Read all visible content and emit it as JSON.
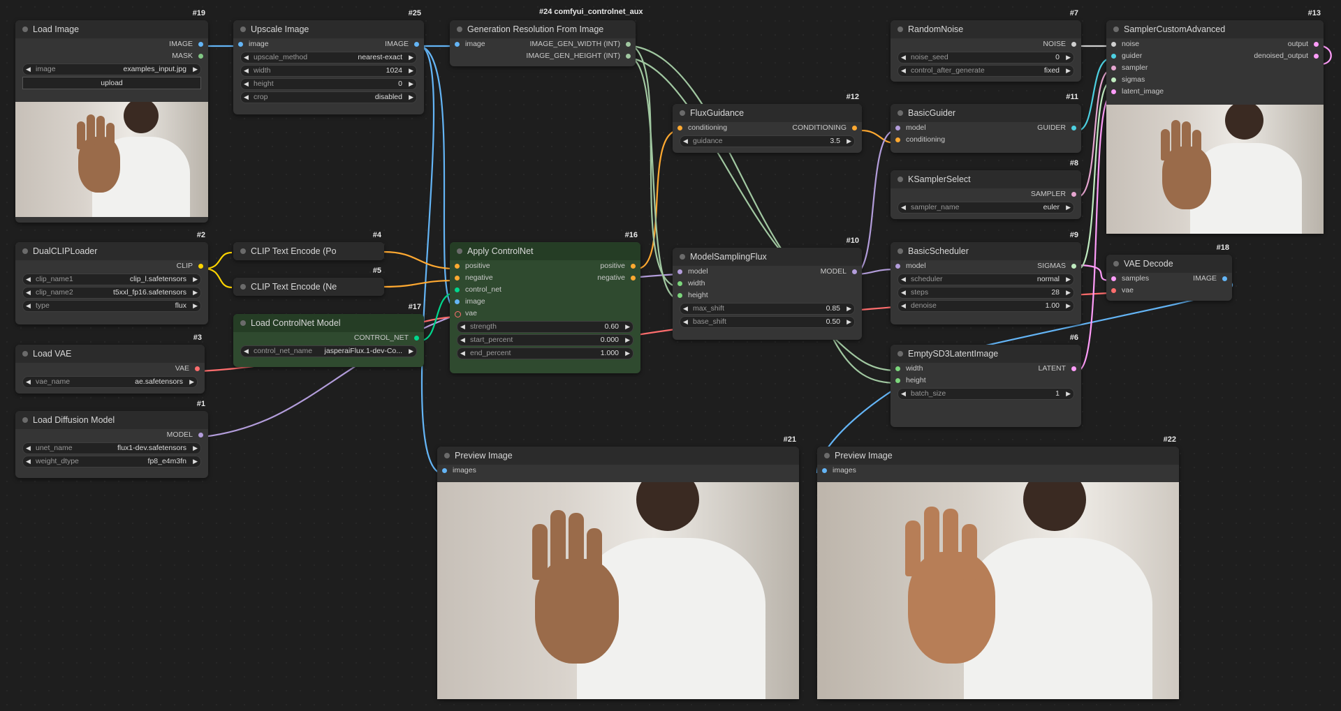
{
  "group_label": "#24 comfyui_controlnet_aux",
  "nodes": {
    "load_image": {
      "id": "#19",
      "title": "Load Image",
      "out1": "IMAGE",
      "out2": "MASK",
      "w_image_label": "image",
      "w_image_value": "examples_input.jpg",
      "upload": "upload"
    },
    "upscale": {
      "id": "#25",
      "title": "Upscale Image",
      "in1": "image",
      "out1": "IMAGE",
      "widgets": [
        {
          "label": "upscale_method",
          "value": "nearest-exact"
        },
        {
          "label": "width",
          "value": "1024"
        },
        {
          "label": "height",
          "value": "0"
        },
        {
          "label": "crop",
          "value": "disabled"
        }
      ]
    },
    "genres": {
      "title": "Generation Resolution From Image",
      "in1": "image",
      "out1": "IMAGE_GEN_WIDTH (INT)",
      "out2": "IMAGE_GEN_HEIGHT (INT)"
    },
    "random_noise": {
      "id": "#7",
      "title": "RandomNoise",
      "out1": "NOISE",
      "widgets": [
        {
          "label": "noise_seed",
          "value": "0"
        },
        {
          "label": "control_after_generate",
          "value": "fixed"
        }
      ]
    },
    "sampler_custom": {
      "id": "#13",
      "title": "SamplerCustomAdvanced",
      "in": [
        "noise",
        "guider",
        "sampler",
        "sigmas",
        "latent_image"
      ],
      "out1": "output",
      "out2": "denoised_output"
    },
    "flux_guidance": {
      "id": "#12",
      "title": "FluxGuidance",
      "in1": "conditioning",
      "out1": "CONDITIONING",
      "widgets": [
        {
          "label": "guidance",
          "value": "3.5"
        }
      ]
    },
    "basic_guider": {
      "id": "#11",
      "title": "BasicGuider",
      "in1": "model",
      "in2": "conditioning",
      "out1": "GUIDER"
    },
    "ksampler_select": {
      "id": "#8",
      "title": "KSamplerSelect",
      "out1": "SAMPLER",
      "widgets": [
        {
          "label": "sampler_name",
          "value": "euler"
        }
      ]
    },
    "dual_clip": {
      "id": "#2",
      "title": "DualCLIPLoader",
      "out1": "CLIP",
      "widgets": [
        {
          "label": "clip_name1",
          "value": "clip_l.safetensors"
        },
        {
          "label": "clip_name2",
          "value": "t5xxl_fp16.safetensors"
        },
        {
          "label": "type",
          "value": "flux"
        }
      ]
    },
    "clip_pos": {
      "id": "#4",
      "title": "CLIP Text Encode (Po"
    },
    "clip_neg": {
      "id": "#5",
      "title": "CLIP Text Encode (Ne"
    },
    "apply_cn": {
      "id": "#16",
      "title": "Apply ControlNet",
      "in": [
        "positive",
        "negative",
        "control_net",
        "image",
        "vae"
      ],
      "out1": "positive",
      "out2": "negative",
      "widgets": [
        {
          "label": "strength",
          "value": "0.60"
        },
        {
          "label": "start_percent",
          "value": "0.000"
        },
        {
          "label": "end_percent",
          "value": "1.000"
        }
      ]
    },
    "model_sampling": {
      "id": "#10",
      "title": "ModelSamplingFlux",
      "in": [
        "model",
        "width",
        "height"
      ],
      "out1": "MODEL",
      "widgets": [
        {
          "label": "max_shift",
          "value": "0.85"
        },
        {
          "label": "base_shift",
          "value": "0.50"
        }
      ]
    },
    "basic_scheduler": {
      "id": "#9",
      "title": "BasicScheduler",
      "in1": "model",
      "out1": "SIGMAS",
      "widgets": [
        {
          "label": "scheduler",
          "value": "normal"
        },
        {
          "label": "steps",
          "value": "28"
        },
        {
          "label": "denoise",
          "value": "1.00"
        }
      ]
    },
    "vae_decode": {
      "id": "#18",
      "title": "VAE Decode",
      "in1": "samples",
      "in2": "vae",
      "out1": "IMAGE"
    },
    "load_cn": {
      "id": "#17",
      "title": "Load ControlNet Model",
      "out1": "CONTROL_NET",
      "widgets": [
        {
          "label": "control_net_name",
          "value": "jasperaiFlux.1-dev-Co..."
        }
      ]
    },
    "load_vae": {
      "id": "#3",
      "title": "Load VAE",
      "out1": "VAE",
      "widgets": [
        {
          "label": "vae_name",
          "value": "ae.safetensors"
        }
      ]
    },
    "empty_latent": {
      "id": "#6",
      "title": "EmptySD3LatentImage",
      "in1": "width",
      "in2": "height",
      "out1": "LATENT",
      "widgets": [
        {
          "label": "batch_size",
          "value": "1"
        }
      ]
    },
    "load_diffusion": {
      "id": "#1",
      "title": "Load Diffusion Model",
      "out1": "MODEL",
      "widgets": [
        {
          "label": "unet_name",
          "value": "flux1-dev.safetensors"
        },
        {
          "label": "weight_dtype",
          "value": "fp8_e4m3fn"
        }
      ]
    },
    "preview1": {
      "id": "#21",
      "title": "Preview Image",
      "in1": "images"
    },
    "preview2": {
      "id": "#22",
      "title": "Preview Image",
      "in1": "images"
    }
  },
  "colors": {
    "image": "#64b5f6",
    "clip": "#ffd500",
    "conditioning": "#ffa931",
    "model": "#b39ddb",
    "vae": "#ff6e6e",
    "latent": "#ff9cf9",
    "control_net": "#00d78d",
    "int": "#a1c8a1"
  }
}
